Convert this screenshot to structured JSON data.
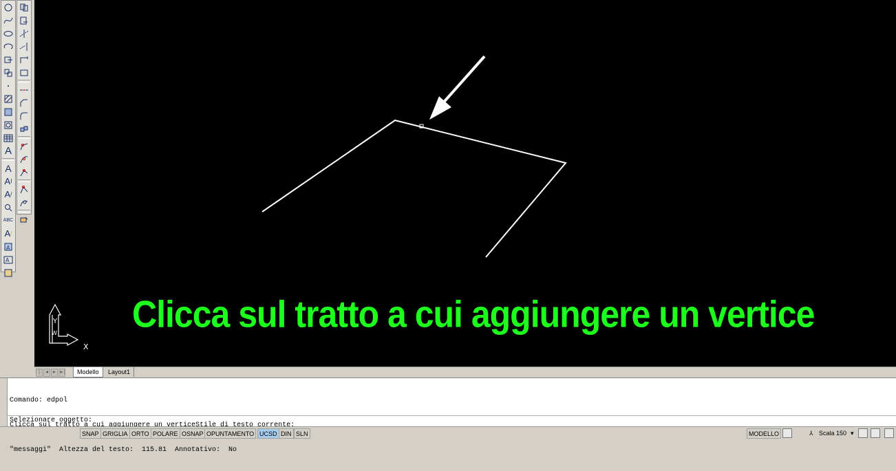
{
  "canvas": {
    "instruction": "Clicca sul tratto a cui aggiungere un vertice",
    "instruction_color": "#1dff1d",
    "background": "#000000",
    "ucs": {
      "x_label": "X",
      "y_label": "Y",
      "w_label": "W"
    }
  },
  "layout_tabs": [
    {
      "label": "Modello",
      "active": true
    },
    {
      "label": "Layout1",
      "active": false
    }
  ],
  "command_line": {
    "history": [
      "Comando: edpol",
      "Clicca sul tratto a cui aggiungere un verticeStile di testo corrente:",
      "\"messaggi\"  Altezza del testo:  115.81  Annotativo:  No"
    ],
    "prompt": "Selezionare oggetto:"
  },
  "status_bar": {
    "toggles": [
      {
        "label": "SNAP",
        "on": false
      },
      {
        "label": "GRIGLIA",
        "on": false
      },
      {
        "label": "ORTO",
        "on": false
      },
      {
        "label": "POLARE",
        "on": false
      },
      {
        "label": "OSNAP",
        "on": false
      },
      {
        "label": "OPUNTAMENTO",
        "on": false
      },
      {
        "label": "UCSD",
        "on": true
      },
      {
        "label": "DIN",
        "on": false
      },
      {
        "label": "SLN",
        "on": false
      }
    ],
    "space": "MODELLO",
    "scale": "Scala 150"
  },
  "left_toolbar": {
    "draw_tools": [
      "circle-icon",
      "spline-icon",
      "ellipse-icon",
      "ellipse-arc-icon",
      "insert-block-icon",
      "make-block-icon",
      "point-icon",
      "hatch-icon",
      "gradient-icon",
      "region-icon",
      "table-icon",
      "multiline-text-icon",
      "text-icon",
      "text-align-icon",
      "text-style-icon",
      "find-replace-icon",
      "spell-check-icon",
      "text-edit-icon",
      "field-icon",
      "multiline-attr-icon",
      "text-scale-icon"
    ],
    "modify_tools": [
      "copy-icon",
      "stretch-icon",
      "trim-icon",
      "extend-icon",
      "break-icon",
      "join-icon",
      "break-at-point-icon",
      "chamfer-icon",
      "fillet-icon",
      "array-3d-icon",
      "polyline-edit-icon",
      "spline-edit-icon",
      "vertex-edit-icon",
      "add-vertex-icon",
      "remove-vertex-icon",
      "convert-icon",
      "curve-icon"
    ]
  }
}
